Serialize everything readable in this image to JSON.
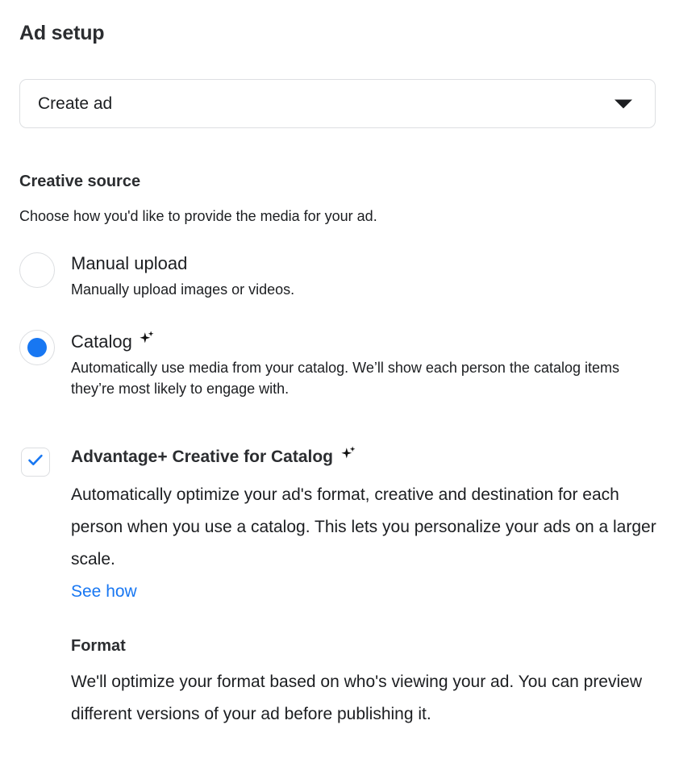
{
  "page": {
    "title": "Ad setup"
  },
  "ad_type_dropdown": {
    "selected": "Create ad",
    "caret_icon": "chevron-down-icon"
  },
  "creative_source": {
    "heading": "Creative source",
    "subtext": "Choose how you'd like to provide the media for your ad.",
    "options": [
      {
        "id": "manual-upload",
        "label": "Manual upload",
        "description": "Manually upload images or videos.",
        "selected": false,
        "has_sparkle": false
      },
      {
        "id": "catalog",
        "label": "Catalog",
        "description": "Automatically use media from your catalog. We’ll show each person the catalog items they’re most likely to engage with.",
        "selected": true,
        "has_sparkle": true,
        "sparkle_icon": "sparkle-icon"
      }
    ]
  },
  "advantage_plus": {
    "checked": true,
    "checkbox_icon": "check-icon",
    "sparkle_icon": "sparkle-icon",
    "title": "Advantage+ Creative for Catalog",
    "description": "Automatically optimize your ad's format, creative and destination for each person when you use a catalog. This lets you personalize your ads on a larger scale.",
    "link_label": "See how"
  },
  "format": {
    "heading": "Format",
    "description": "We'll optimize your format based on who's viewing your ad. You can preview different versions of your ad before publishing it."
  },
  "colors": {
    "accent_blue": "#1877f2",
    "text_primary": "#1c1e21",
    "heading": "#2b2d30",
    "border": "#dcdee1",
    "background": "#ffffff"
  }
}
